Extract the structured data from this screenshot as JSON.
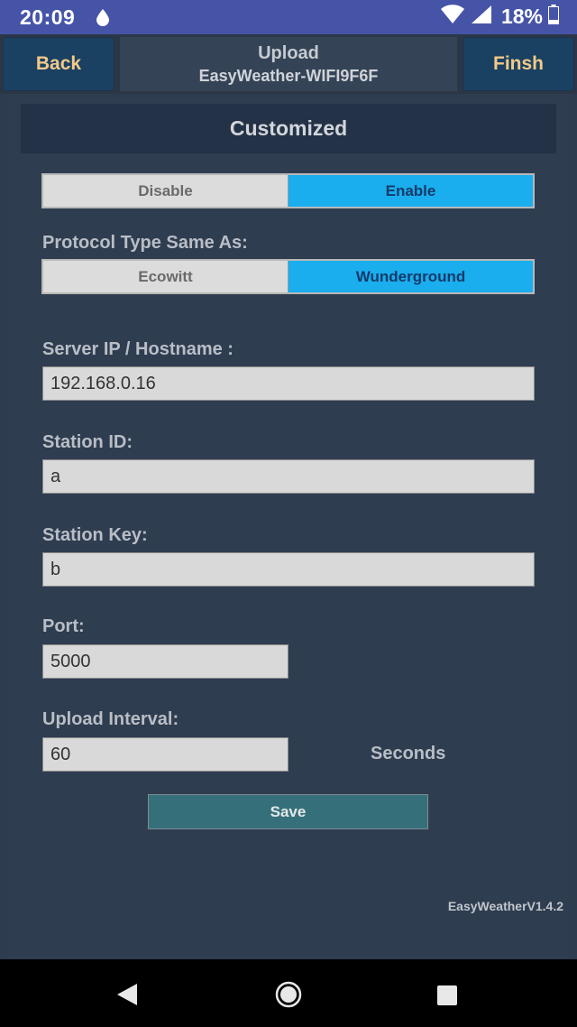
{
  "status_bar": {
    "time": "20:09",
    "battery": "18%"
  },
  "header": {
    "back_label": "Back",
    "title": "Upload",
    "subtitle": "EasyWeather-WIFI9F6F",
    "finish_label": "Finsh"
  },
  "section": {
    "title": "Customized"
  },
  "enable_toggle": {
    "options": [
      "Disable",
      "Enable"
    ],
    "selected": "Enable"
  },
  "protocol": {
    "label": "Protocol Type Same As:",
    "options": [
      "Ecowitt",
      "Wunderground"
    ],
    "selected": "Wunderground"
  },
  "form": {
    "server_label": "Server IP / Hostname :",
    "server_value": "192.168.0.16",
    "station_id_label": "Station ID:",
    "station_id_value": "a",
    "station_key_label": "Station Key:",
    "station_key_value": "b",
    "port_label": "Port:",
    "port_value": "5000",
    "interval_label": "Upload Interval:",
    "interval_value": "60",
    "interval_unit": "Seconds"
  },
  "save_label": "Save",
  "version": "EasyWeatherV1.4.2",
  "colors": {
    "background": "#2e3c50",
    "accent_selected": "#1aaeee",
    "header_button": "#1a4162",
    "header_button_text": "#f2c98a",
    "save_button": "#35707a",
    "status_bar": "#4654a8"
  },
  "icons": {
    "status": [
      "water-drop-icon",
      "wifi-icon",
      "signal-icon",
      "battery-icon"
    ],
    "nav": [
      "nav-back-icon",
      "nav-home-icon",
      "nav-recents-icon"
    ]
  }
}
